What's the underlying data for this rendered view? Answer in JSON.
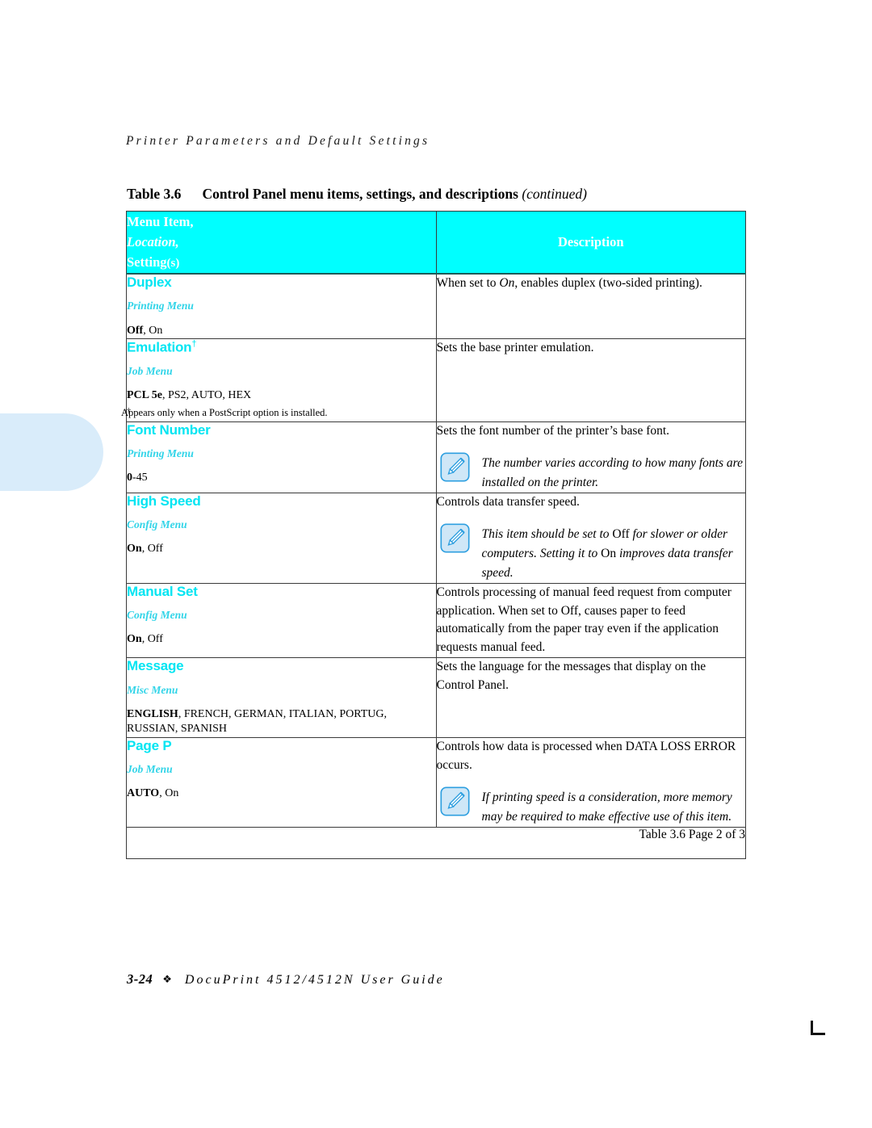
{
  "page": {
    "running_header": "Printer Parameters and Default Settings",
    "caption_number": "Table 3.6",
    "caption_title": "Control Panel menu items, settings, and descriptions",
    "caption_continued": "(continued)",
    "footer_folio": "3-24",
    "footer_diamond": "❖",
    "footer_guide": "DocuPrint 4512/4512N User Guide",
    "page_of": "Table 3.6  Page 2 of 3",
    "colors": {
      "header_bg": "#00ffff",
      "header_text": "#ffffff",
      "item_name": "#00e5f2",
      "item_location": "#31d4e8",
      "tab_fill": "#d9ecfa",
      "note_icon_fill": "#cfe7f7",
      "note_icon_stroke": "#2e9fe0"
    }
  },
  "table": {
    "headers": {
      "col1_line1": "Menu Item,",
      "col1_line2": "Location,",
      "col1_line3_a": "Setting",
      "col1_line3_b": "(s)",
      "col2": "Description"
    },
    "rows": [
      {
        "name": "Duplex",
        "dagger": "",
        "location": "Printing Menu",
        "settings_default": "Off",
        "settings_rest": ", On",
        "footnote_mark": "",
        "footnote_text": "",
        "description_pre": "When set to ",
        "description_italic": "On",
        "description_post": ", enables duplex (two-sided printing).",
        "note": null
      },
      {
        "name": "Emulation",
        "dagger": "†",
        "location": "Job Menu",
        "settings_default": "PCL 5e",
        "settings_rest": ", PS2, AUTO, HEX",
        "footnote_mark": "†",
        "footnote_text": "Appears only when a PostScript option is installed.",
        "description_pre": "Sets the base printer emulation.",
        "description_italic": "",
        "description_post": "",
        "note": null
      },
      {
        "name": "Font Number",
        "dagger": "",
        "location": "Printing Menu",
        "settings_default": "0",
        "settings_rest": "-45",
        "footnote_mark": "",
        "footnote_text": "",
        "description_pre": "Sets the font number of the printer’s base font.",
        "description_italic": "",
        "description_post": "",
        "note": {
          "segments": [
            {
              "text": "The number varies according to how many fonts are installed on the printer.",
              "roman": false
            }
          ]
        }
      },
      {
        "name": "High Speed",
        "dagger": "",
        "location": "Config Menu",
        "settings_default": "On",
        "settings_rest": ", Off",
        "footnote_mark": "",
        "footnote_text": "",
        "description_pre": "Controls data transfer speed.",
        "description_italic": "",
        "description_post": "",
        "note": {
          "segments": [
            {
              "text": "This item should be set to ",
              "roman": false
            },
            {
              "text": "Off",
              "roman": true
            },
            {
              "text": " for slower or older computers. Setting it to ",
              "roman": false
            },
            {
              "text": "On",
              "roman": true
            },
            {
              "text": " improves data transfer speed.",
              "roman": false
            }
          ]
        }
      },
      {
        "name": "Manual Set",
        "dagger": "",
        "location": "Config Menu",
        "settings_default": "On",
        "settings_rest": ", Off",
        "footnote_mark": "",
        "footnote_text": "",
        "description_pre": "Controls processing of manual feed request from computer application. When set to Off, causes paper to feed automatically from the paper tray even if the application requests manual feed.",
        "description_italic": "",
        "description_post": "",
        "note": null
      },
      {
        "name": "Message",
        "dagger": "",
        "location": "Misc Menu",
        "settings_default": "ENGLISH",
        "settings_rest": ", FRENCH, GERMAN, ITALIAN, PORTUG, RUSSIAN, SPANISH",
        "footnote_mark": "",
        "footnote_text": "",
        "description_pre": "Sets the language for the messages that display on the Control Panel.",
        "description_italic": "",
        "description_post": "",
        "note": null
      },
      {
        "name": "Page P",
        "dagger": "",
        "location": "Job Menu",
        "settings_default": "AUTO",
        "settings_rest": ", On",
        "footnote_mark": "",
        "footnote_text": "",
        "description_pre": "Controls how data is processed when DATA LOSS ERROR occurs.",
        "description_italic": "",
        "description_post": "",
        "note": {
          "segments": [
            {
              "text": "If printing speed is a consideration, more memory may be required to make effective use of this item.",
              "roman": false
            }
          ]
        }
      }
    ]
  }
}
